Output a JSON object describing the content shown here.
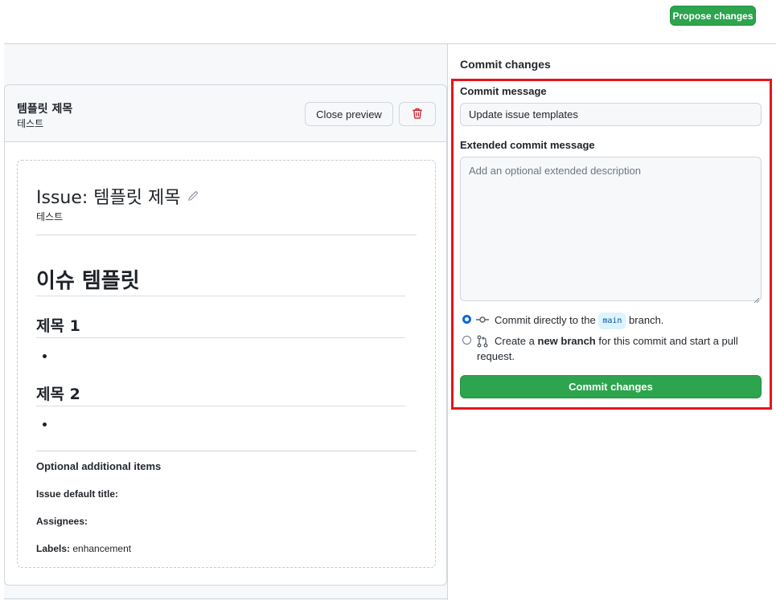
{
  "topbar": {
    "propose_label": "Propose changes"
  },
  "preview": {
    "template_title": "템플릿 제목",
    "template_subtitle": "테스트",
    "close_label": "Close preview",
    "issue_title": "Issue: 템플릿 제목",
    "issue_subtitle": "테스트",
    "h1": "이슈 템플릿",
    "h2_1": "제목 1",
    "h2_2": "제목 2",
    "optional_title": "Optional additional items",
    "default_title_label": "Issue default title:",
    "default_title_value": "",
    "assignees_label": "Assignees:",
    "assignees_value": "",
    "labels_label": "Labels:",
    "labels_value": "enhancement"
  },
  "commit": {
    "heading": "Commit changes",
    "message_label": "Commit message",
    "message_value": "Update issue templates",
    "ext_label": "Extended commit message",
    "ext_placeholder": "Add an optional extended description",
    "option_direct_pre": "Commit directly to the",
    "option_direct_branch": "main",
    "option_direct_post": "branch.",
    "option_new_pre": "Create a",
    "option_new_bold": "new branch",
    "option_new_post": "for this commit and start a pull",
    "option_new_post2": "request.",
    "button_label": "Commit changes"
  },
  "colors": {
    "accent_green": "#2da44e",
    "highlight_red": "#e8141c",
    "link_blue": "#0969da"
  },
  "icons": [
    "pencil-icon",
    "trash-icon",
    "git-commit-icon",
    "git-pull-request-icon"
  ]
}
